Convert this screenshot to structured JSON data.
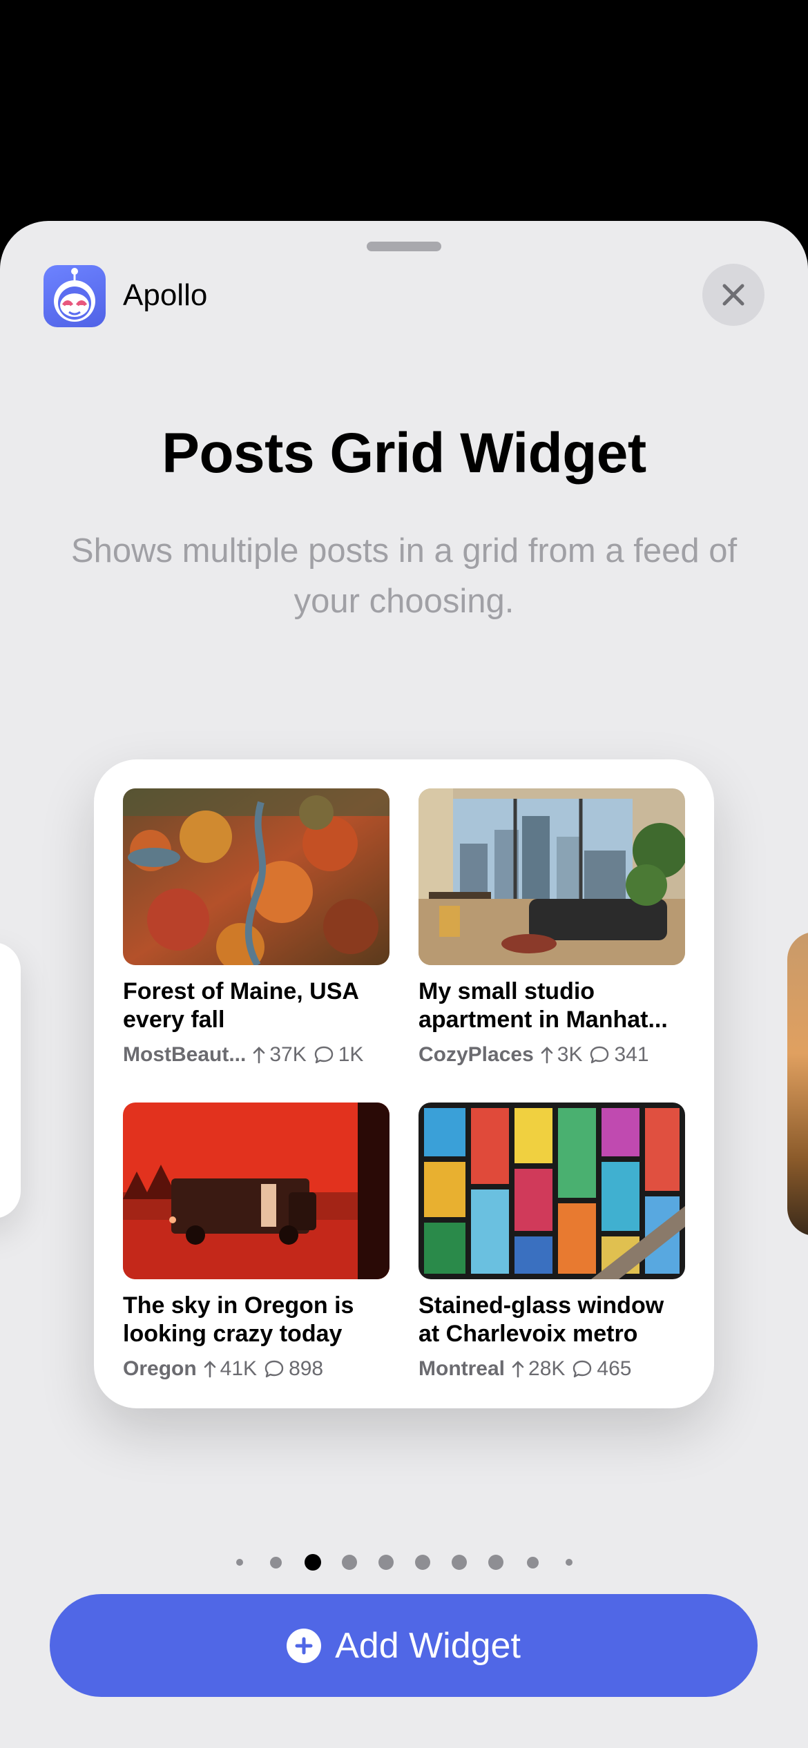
{
  "header": {
    "app_name": "Apollo",
    "app_icon": "apollo-robot-icon",
    "close_icon": "close-icon"
  },
  "widget_info": {
    "title": "Posts Grid Widget",
    "description": "Shows multiple posts in a grid from a feed of your choosing."
  },
  "posts": [
    {
      "title": "Forest of Maine, USA every fall",
      "subreddit": "MostBeaut...",
      "upvotes": "37K",
      "comments": "1K",
      "thumb": "autumn-forest-aerial"
    },
    {
      "title": "My small studio apartment in Manhat...",
      "subreddit": "CozyPlaces",
      "upvotes": "3K",
      "comments": "341",
      "thumb": "studio-apartment-view"
    },
    {
      "title": "The sky in Oregon is looking crazy today",
      "subreddit": "Oregon",
      "upvotes": "41K",
      "comments": "898",
      "thumb": "red-sky-delivery-truck"
    },
    {
      "title": "Stained-glass window at Charlevoix metro",
      "subreddit": "Montreal",
      "upvotes": "28K",
      "comments": "465",
      "thumb": "stained-glass-window"
    }
  ],
  "pagination": {
    "count": 10,
    "active_index": 2
  },
  "add_button": {
    "label": "Add Widget",
    "icon": "plus-circle-icon"
  },
  "colors": {
    "accent": "#5067e6",
    "sheet_background": "#ebebed",
    "secondary_text": "#a0a0a5"
  }
}
